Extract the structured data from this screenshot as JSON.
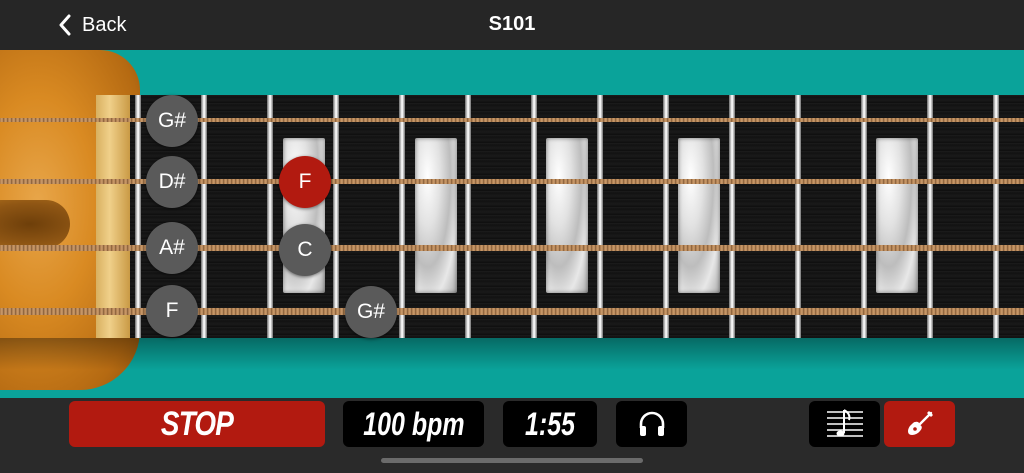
{
  "header": {
    "back_label": "Back",
    "title": "S101"
  },
  "fretboard": {
    "strings": [
      {
        "name": "string-1"
      },
      {
        "name": "string-2"
      },
      {
        "name": "string-3"
      },
      {
        "name": "string-4"
      }
    ],
    "open_notes": [
      "G#",
      "D#",
      "A#",
      "F"
    ],
    "fretted_notes": [
      {
        "label": "F",
        "state": "active",
        "string": 2,
        "fret": 2
      },
      {
        "label": "C",
        "state": "normal",
        "string": 3,
        "fret": 2
      },
      {
        "label": "G#",
        "state": "normal",
        "string": 4,
        "fret": 3
      }
    ],
    "colors": {
      "accent_red": "#b21a10",
      "note_gray": "#5a5a5a",
      "teal_background": "#0aa39a"
    }
  },
  "toolbar": {
    "stop_label": "STOP",
    "tempo_label": "100 bpm",
    "time_label": "1:55",
    "audio_icon": "headphones-icon",
    "score_icon": "sheet-music-icon",
    "instrument_icon": "guitar-icon"
  }
}
